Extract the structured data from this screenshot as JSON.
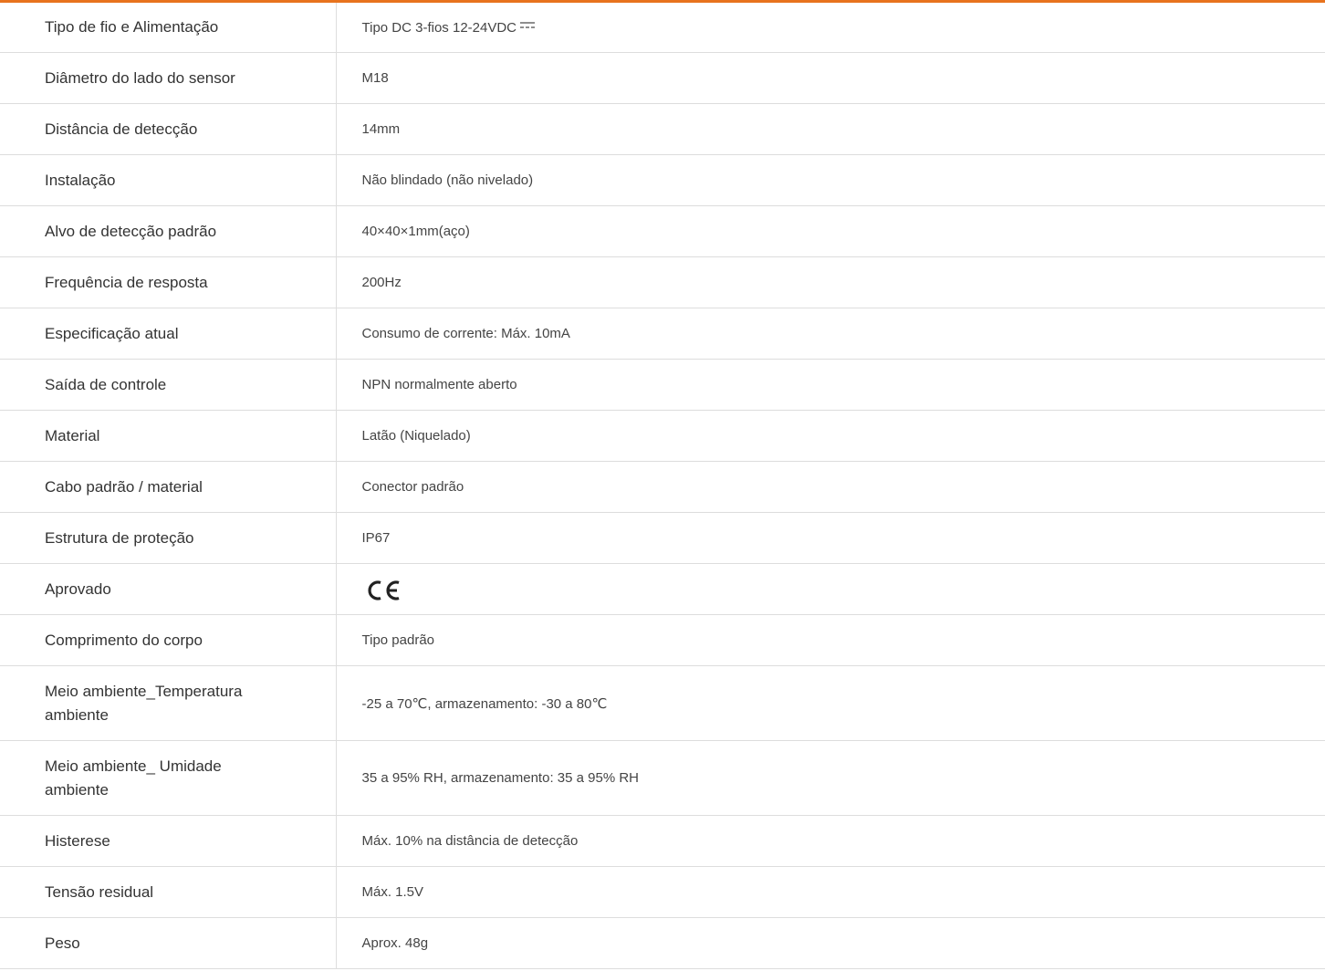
{
  "accent_color": "#e8731e",
  "rows": [
    {
      "label": "Tipo de fio e Alimentação",
      "value": "Tipo DC 3-fios 12-24VDC",
      "icon": "dc-symbol-icon"
    },
    {
      "label": "Diâmetro do lado do sensor",
      "value": "M18"
    },
    {
      "label": "Distância de detecção",
      "value": "14mm"
    },
    {
      "label": "Instalação",
      "value": "Não blindado (não nivelado)"
    },
    {
      "label": "Alvo de detecção padrão",
      "value": "40×40×1mm(aço)"
    },
    {
      "label": "Frequência de resposta",
      "value": "200Hz"
    },
    {
      "label": "Especificação atual",
      "value": "Consumo de corrente: Máx. 10mA"
    },
    {
      "label": "Saída de controle",
      "value": "NPN normalmente aberto"
    },
    {
      "label": "Material",
      "value": "Latão (Niquelado)"
    },
    {
      "label": "Cabo padrão / material",
      "value": "Conector padrão"
    },
    {
      "label": "Estrutura de proteção",
      "value": "IP67"
    },
    {
      "label": "Aprovado",
      "value": "",
      "icon": "ce-mark-icon"
    },
    {
      "label": "Comprimento do corpo",
      "value": "Tipo padrão"
    },
    {
      "label": "Meio ambiente_Temperatura ambiente",
      "value": "-25 a 70℃, armazenamento: -30 a 80℃"
    },
    {
      "label": "Meio ambiente_ Umidade ambiente",
      "value": "35 a 95% RH, armazenamento: 35 a 95% RH"
    },
    {
      "label": "Histerese",
      "value": "Máx. 10% na distância de detecção"
    },
    {
      "label": "Tensão residual",
      "value": "Máx. 1.5V"
    },
    {
      "label": "Peso",
      "value": "Aprox. 48g"
    }
  ]
}
